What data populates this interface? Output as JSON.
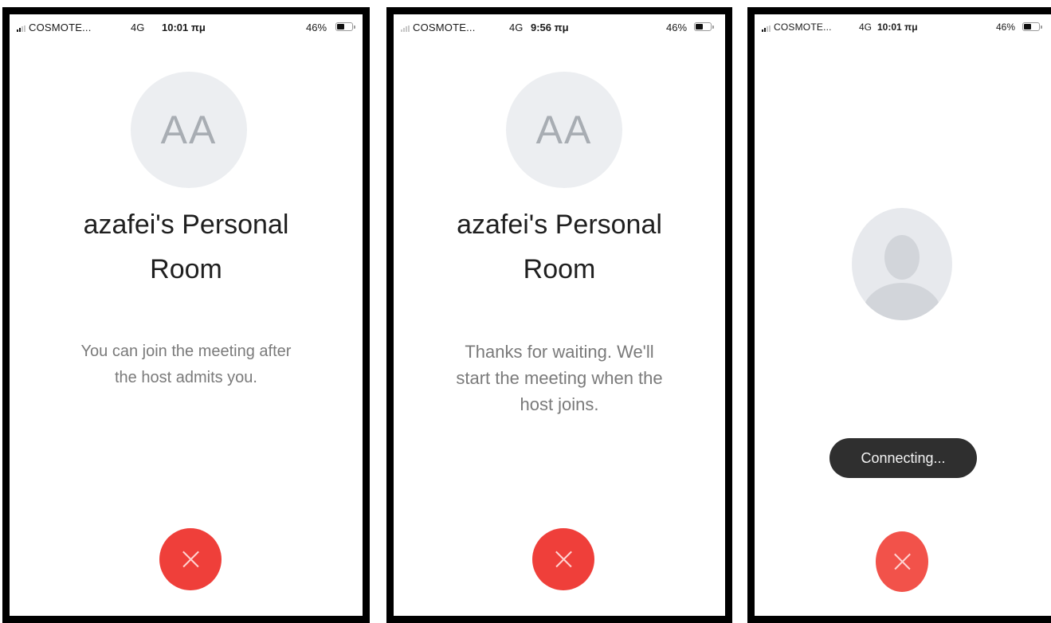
{
  "screens": [
    {
      "status_bar": {
        "carrier": "COSMOTE...",
        "network": "4G",
        "time": "10:01 πμ",
        "battery_percent": "46%",
        "battery_level": 0.46
      },
      "avatar_initials": "AA",
      "meeting_title_line1": "azafei's Personal",
      "meeting_title_line2": "Room",
      "message_line1": "You can join the meeting after",
      "message_line2": "the host admits you.",
      "end_call_icon": "close-x-icon"
    },
    {
      "status_bar": {
        "carrier": "COSMOTE...",
        "network": "4G",
        "time": "9:56 πμ",
        "battery_percent": "46%",
        "battery_level": 0.46
      },
      "avatar_initials": "AA",
      "meeting_title_line1": "azafei's Personal",
      "meeting_title_line2": "Room",
      "message_line1": "Thanks for waiting. We'll",
      "message_line2": "start the meeting when the",
      "message_line3": "host joins.",
      "end_call_icon": "close-x-icon"
    },
    {
      "status_bar": {
        "carrier": "COSMOTE...",
        "network": "4G",
        "time": "10:01 πμ",
        "battery_percent": "46%",
        "battery_level": 0.46
      },
      "avatar_icon": "profile-silhouette-icon",
      "toast_text": "Connecting...",
      "end_call_icon": "close-x-icon"
    }
  ],
  "colors": {
    "end_call": "#ef3f3a",
    "avatar_background": "#eceef1",
    "toast_background": "#2f2f2f",
    "message_text": "#7a7a7a"
  }
}
